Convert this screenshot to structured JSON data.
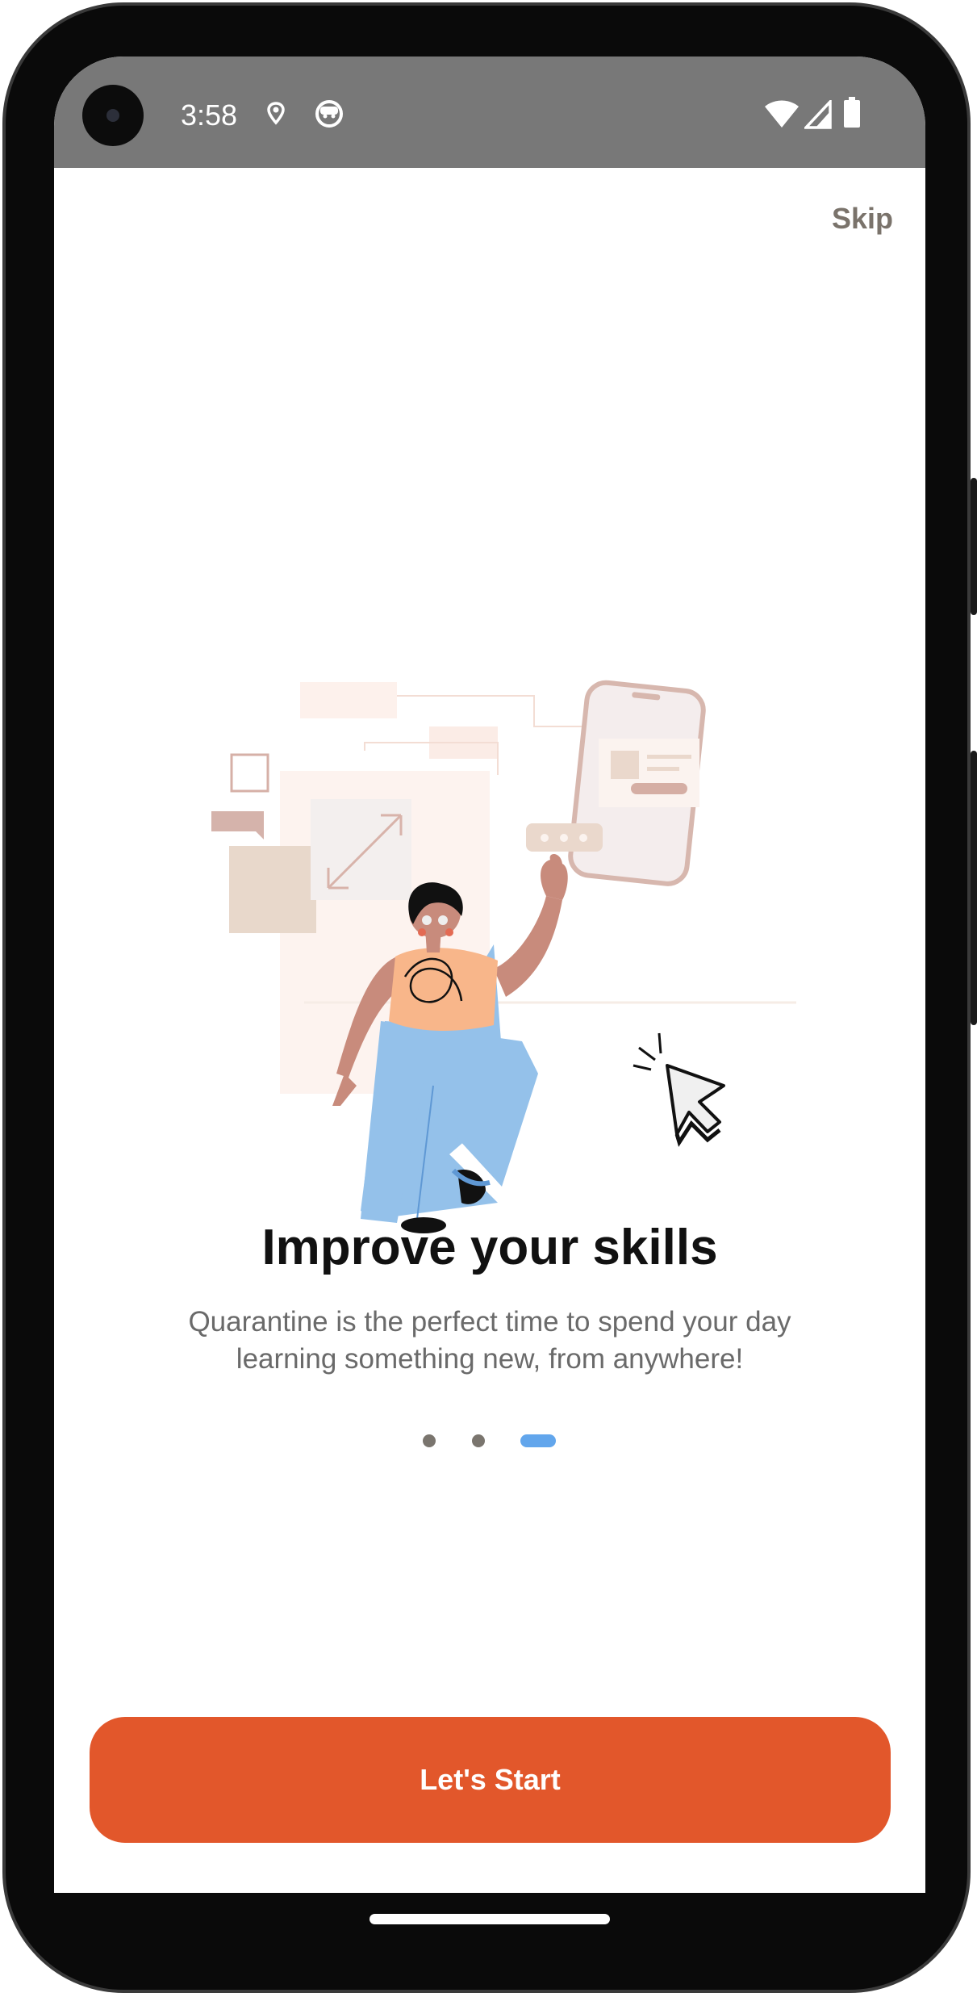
{
  "status_bar": {
    "time": "3:58",
    "left_icons": [
      "location-icon",
      "android-face-icon"
    ],
    "right_icons": [
      "wifi-icon",
      "signal-icon",
      "battery-icon"
    ]
  },
  "header": {
    "skip_label": "Skip"
  },
  "onboarding": {
    "title": "Improve your skills",
    "subtitle": "Quarantine is the perfect time to spend your day learning something new, from anywhere!",
    "page_count": 3,
    "active_page": 3
  },
  "cta": {
    "label": "Let's Start"
  },
  "colors": {
    "accent": "#e2572b",
    "active_dot": "#62a6ec",
    "inactive_dot": "#7a756e",
    "status_bar": "#787878"
  }
}
